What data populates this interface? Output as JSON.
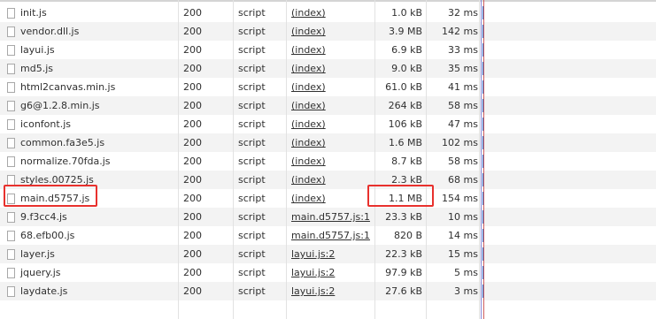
{
  "requests": [
    {
      "name": "init.js",
      "status": "200",
      "type": "script",
      "initiator": "(index)",
      "size": "1.0 kB",
      "time": "32 ms"
    },
    {
      "name": "vendor.dll.js",
      "status": "200",
      "type": "script",
      "initiator": "(index)",
      "size": "3.9 MB",
      "time": "142 ms"
    },
    {
      "name": "layui.js",
      "status": "200",
      "type": "script",
      "initiator": "(index)",
      "size": "6.9 kB",
      "time": "33 ms"
    },
    {
      "name": "md5.js",
      "status": "200",
      "type": "script",
      "initiator": "(index)",
      "size": "9.0 kB",
      "time": "35 ms"
    },
    {
      "name": "html2canvas.min.js",
      "status": "200",
      "type": "script",
      "initiator": "(index)",
      "size": "61.0 kB",
      "time": "41 ms"
    },
    {
      "name": "g6@1.2.8.min.js",
      "status": "200",
      "type": "script",
      "initiator": "(index)",
      "size": "264 kB",
      "time": "58 ms"
    },
    {
      "name": "iconfont.js",
      "status": "200",
      "type": "script",
      "initiator": "(index)",
      "size": "106 kB",
      "time": "47 ms"
    },
    {
      "name": "common.fa3e5.js",
      "status": "200",
      "type": "script",
      "initiator": "(index)",
      "size": "1.6 MB",
      "time": "102 ms"
    },
    {
      "name": "normalize.70fda.js",
      "status": "200",
      "type": "script",
      "initiator": "(index)",
      "size": "8.7 kB",
      "time": "58 ms"
    },
    {
      "name": "styles.00725.js",
      "status": "200",
      "type": "script",
      "initiator": "(index)",
      "size": "2.3 kB",
      "time": "68 ms"
    },
    {
      "name": "main.d5757.js",
      "status": "200",
      "type": "script",
      "initiator": "(index)",
      "size": "1.1 MB",
      "time": "154 ms"
    },
    {
      "name": "9.f3cc4.js",
      "status": "200",
      "type": "script",
      "initiator": "main.d5757.js:1",
      "size": "23.3 kB",
      "time": "10 ms"
    },
    {
      "name": "68.efb00.js",
      "status": "200",
      "type": "script",
      "initiator": "main.d5757.js:1",
      "size": "820 B",
      "time": "14 ms"
    },
    {
      "name": "layer.js",
      "status": "200",
      "type": "script",
      "initiator": "layui.js:2",
      "size": "22.3 kB",
      "time": "15 ms"
    },
    {
      "name": "jquery.js",
      "status": "200",
      "type": "script",
      "initiator": "layui.js:2",
      "size": "97.9 kB",
      "time": "5 ms"
    },
    {
      "name": "laydate.js",
      "status": "200",
      "type": "script",
      "initiator": "layui.js:2",
      "size": "27.6 kB",
      "time": "3 ms"
    }
  ],
  "colors": {
    "highlight_border": "#e8312d",
    "row_alt_bg": "#f3f3f3",
    "waterfall_bar": "#3779d6"
  },
  "icons": {
    "file": "file-icon"
  }
}
